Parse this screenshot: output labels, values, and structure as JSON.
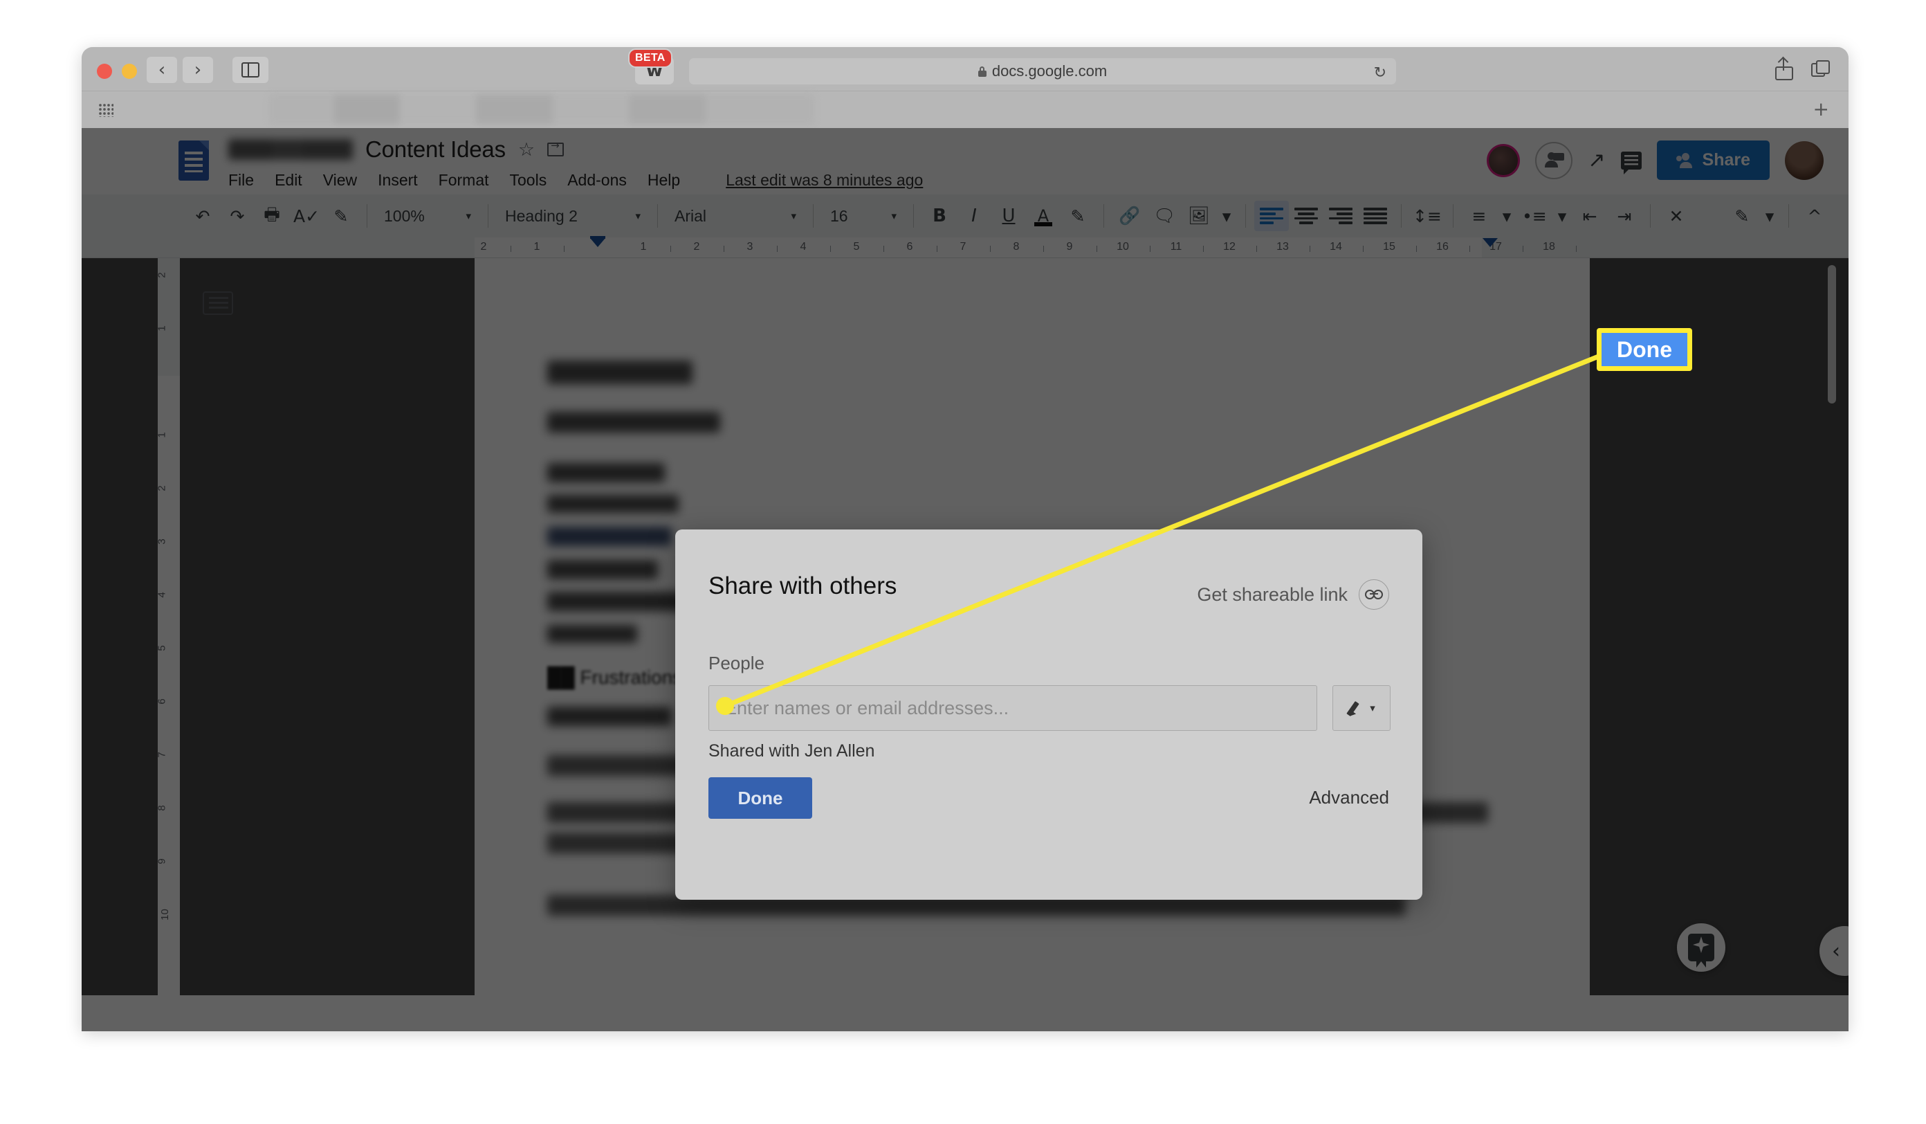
{
  "browser": {
    "url": "docs.google.com",
    "extension_badge": "BETA",
    "extension_icon": "grammarly-icon",
    "reload_icon": "↻",
    "back_icon": "‹",
    "forward_icon": "›",
    "new_tab_icon": "+"
  },
  "docs": {
    "title": "Content Ideas",
    "last_edit": "Last edit was 8 minutes ago",
    "share_button": "Share",
    "menus": [
      "File",
      "Edit",
      "View",
      "Insert",
      "Format",
      "Tools",
      "Add-ons",
      "Help"
    ],
    "toolbar": {
      "zoom": "100%",
      "style": "Heading 2",
      "font": "Arial",
      "size": "16",
      "bold": "B",
      "italic": "I",
      "underline": "U",
      "text_color": "A",
      "caret": "▾",
      "collapse": "^"
    },
    "ruler": {
      "h_ticks": [
        "2",
        "1",
        "1",
        "2",
        "3",
        "4",
        "5",
        "6",
        "7",
        "8",
        "9",
        "10",
        "11",
        "12",
        "13",
        "14",
        "15",
        "16",
        "17",
        "18"
      ],
      "v_ticks": [
        "2",
        "1",
        "1",
        "2",
        "3",
        "4",
        "5",
        "6",
        "7",
        "8",
        "9",
        "10"
      ]
    }
  },
  "share_dialog": {
    "title": "Share with others",
    "get_link_label": "Get shareable link",
    "people_label": "People",
    "input_placeholder": "Enter names or email addresses...",
    "shared_with": "Shared with Jen Allen",
    "done_label": "Done",
    "advanced_label": "Advanced"
  },
  "annotation": {
    "callout_label": "Done",
    "highlight_color": "#ffec33",
    "callout_fill": "#4a90f0",
    "line_color": "#f7e836"
  }
}
